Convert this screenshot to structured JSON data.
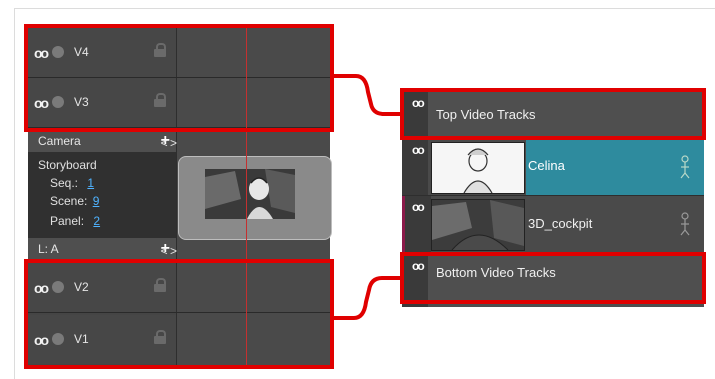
{
  "timeline": {
    "top_tracks": [
      {
        "name": "V4"
      },
      {
        "name": "V3"
      }
    ],
    "camera": {
      "label": "Camera",
      "prev": "<",
      "add": "+",
      "next": ">"
    },
    "storyboard": {
      "title": "Storyboard",
      "seq_label": "Seq.:",
      "seq_value": "1",
      "scene_label": "Scene:",
      "scene_value": "9",
      "panel_label": "Panel:",
      "panel_value": "2"
    },
    "audio": {
      "label": "L: A",
      "prev": "<",
      "add": "+",
      "next": ">"
    },
    "bottom_tracks": [
      {
        "name": "V2"
      },
      {
        "name": "V1"
      }
    ]
  },
  "layers": {
    "top_group": "Top Video Tracks",
    "items": [
      {
        "name": "Celina",
        "color": "#2e8b9e"
      },
      {
        "name": "3D_cockpit",
        "color": "#4a4a4a"
      }
    ],
    "bottom_group": "Bottom Video Tracks"
  },
  "colors": {
    "highlight": "#e00000",
    "playhead": "#c43030",
    "link": "#4fb3ff",
    "selected_layer": "#2e8b9e"
  }
}
